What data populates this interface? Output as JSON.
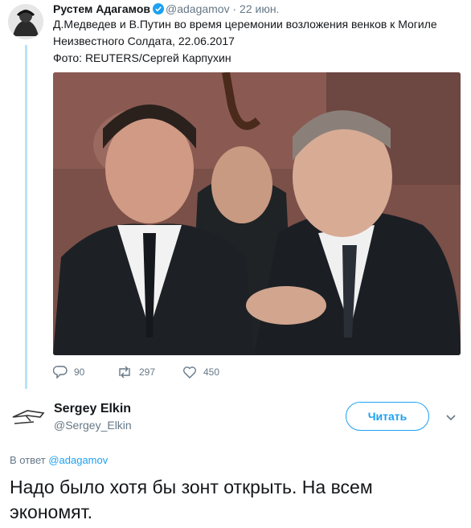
{
  "quoted": {
    "name": "Рустем Адагамов",
    "handle": "@adagamov",
    "separator": "·",
    "date": "22 июн.",
    "text_line1": "Д.Медведев и В.Путин во время церемонии возложения венков к Могиле",
    "text_line2": "Неизвестного Солдата, 22.06.2017",
    "text_line3": "Фото: REUTERS/Сергей Карпухин",
    "replies": "90",
    "retweets": "297",
    "likes": "450",
    "verified_color": "#1da1f2"
  },
  "reply": {
    "name": "Sergey Elkin",
    "handle": "@Sergey_Elkin",
    "follow_label": "Читать",
    "in_reply_prefix": "В ответ",
    "in_reply_mention": "@adagamov",
    "text": "Надо было хотя бы зонт открыть. На всем экономят."
  },
  "colors": {
    "accent": "#1da1f2",
    "thread": "#b7e3f6",
    "muted": "#657786"
  }
}
